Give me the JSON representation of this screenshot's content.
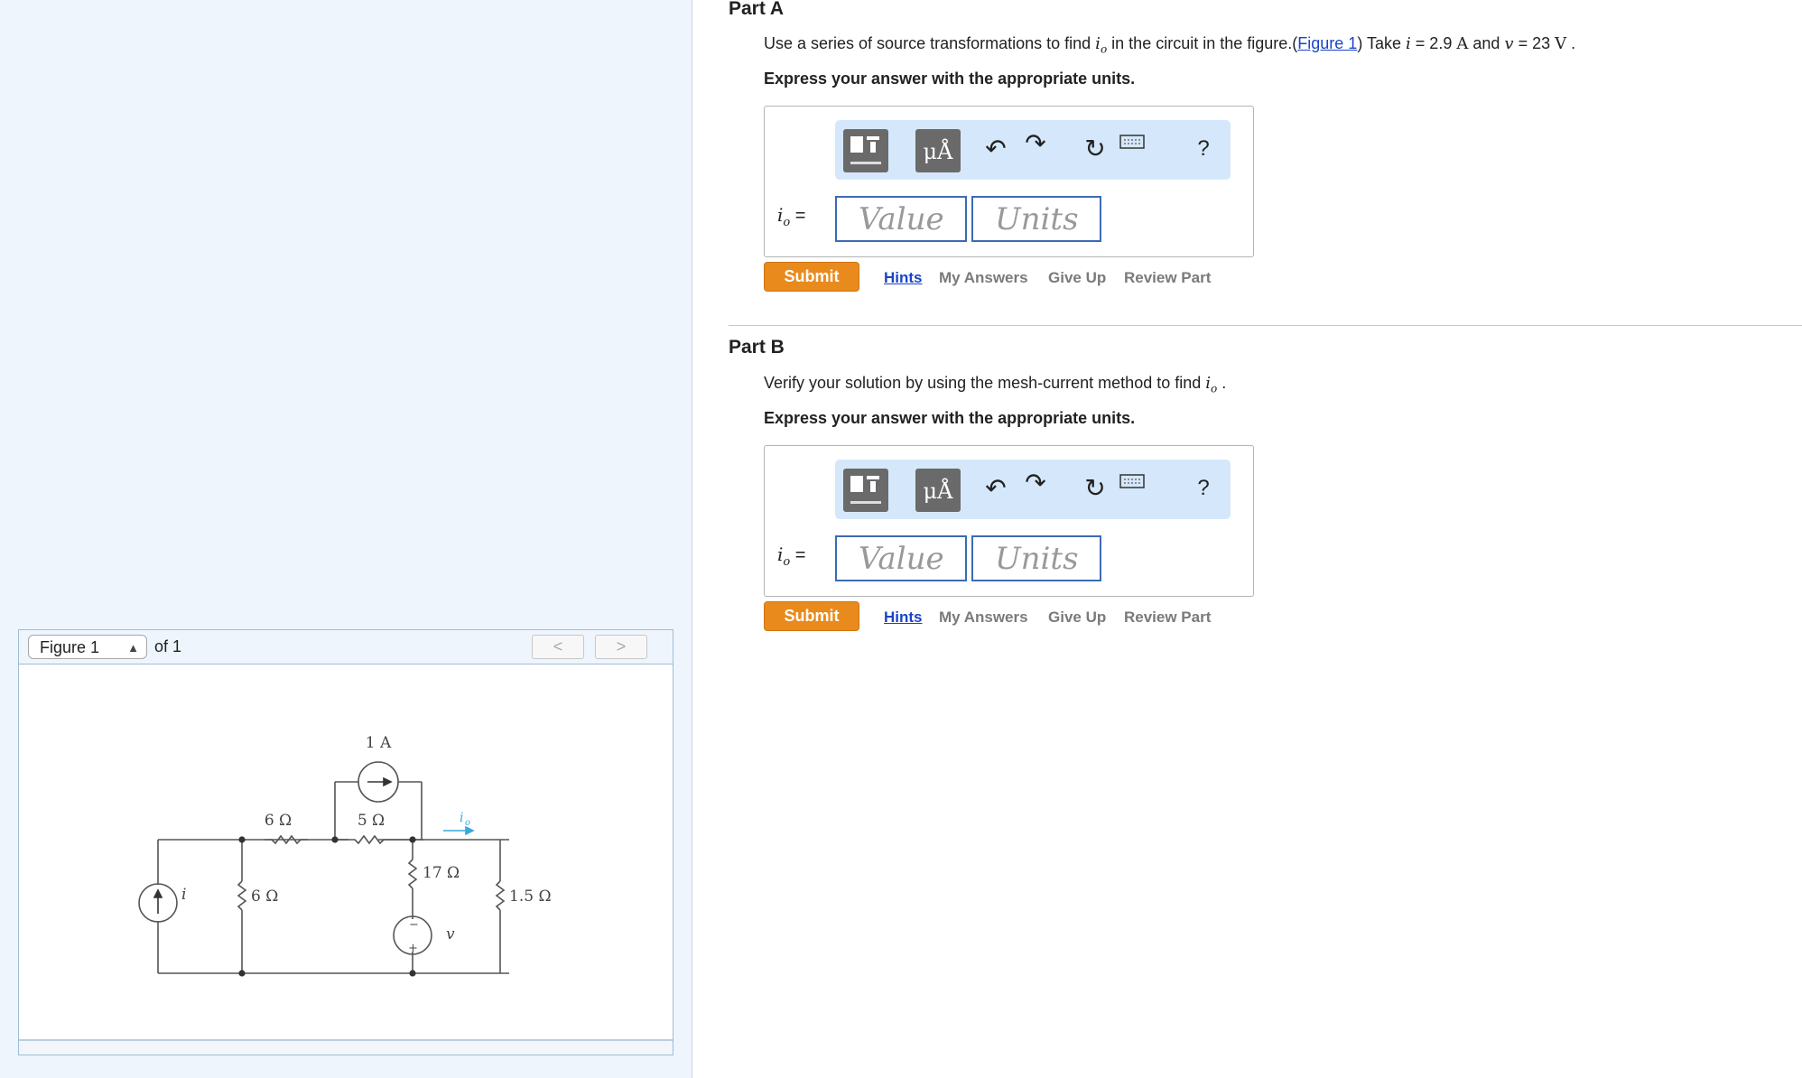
{
  "figure_panel": {
    "selector_value": "Figure 1",
    "of_text": "of 1",
    "prev_label": "<",
    "next_label": ">",
    "circuit": {
      "current_source_top": "1 A",
      "res_6_top": "6 Ω",
      "res_5": "5 Ω",
      "io_label": "i",
      "io_sub": "o",
      "res_17": "17 Ω",
      "res_6_left": "6 Ω",
      "res_1_5": "1.5 Ω",
      "source_i": "i",
      "source_v": "v",
      "plus": "+",
      "minus": "−"
    }
  },
  "partA": {
    "heading": "Part A",
    "prompt_pre": "Use a series of source transformations to find ",
    "prompt_var": "i",
    "prompt_var_sub": "o",
    "prompt_mid": " in the circuit in the figure.(",
    "figure_link": "Figure 1",
    "prompt_post1": ") Take ",
    "var_i": "i",
    "eq1": " = 2.9 ",
    "unit_A": "A",
    "and_text": " and ",
    "var_v": "v",
    "eq2": " = 23 ",
    "unit_V": "V",
    "period": " .",
    "instruction": "Express your answer with the appropriate units.",
    "answer_label": "i",
    "answer_label_sub": "o",
    "answer_eq": " =",
    "value_placeholder": "Value",
    "units_placeholder": "Units",
    "submit": "Submit",
    "links": [
      "Hints",
      "My Answers",
      "Give Up",
      "Review Part"
    ]
  },
  "partB": {
    "heading": "Part B",
    "prompt_pre": "Verify your solution by using the mesh-current method to find ",
    "prompt_var": "i",
    "prompt_var_sub": "o",
    "period": " .",
    "instruction": "Express your answer with the appropriate units.",
    "answer_label": "i",
    "answer_label_sub": "o",
    "answer_eq": " =",
    "value_placeholder": "Value",
    "units_placeholder": "Units",
    "submit": "Submit",
    "links": [
      "Hints",
      "My Answers",
      "Give Up",
      "Review Part"
    ]
  },
  "toolbar": {
    "units_button": "μÅ",
    "help": "?",
    "icons": [
      "templates-icon",
      "units-icon",
      "undo-icon",
      "redo-icon",
      "reset-icon",
      "keyboard-icon",
      "help-icon"
    ]
  },
  "colors": {
    "link": "#1a44c7",
    "submit": "#e98a1c",
    "toolbar_bg": "#d5e8fb",
    "left_pane_bg": "#eef5fc"
  }
}
